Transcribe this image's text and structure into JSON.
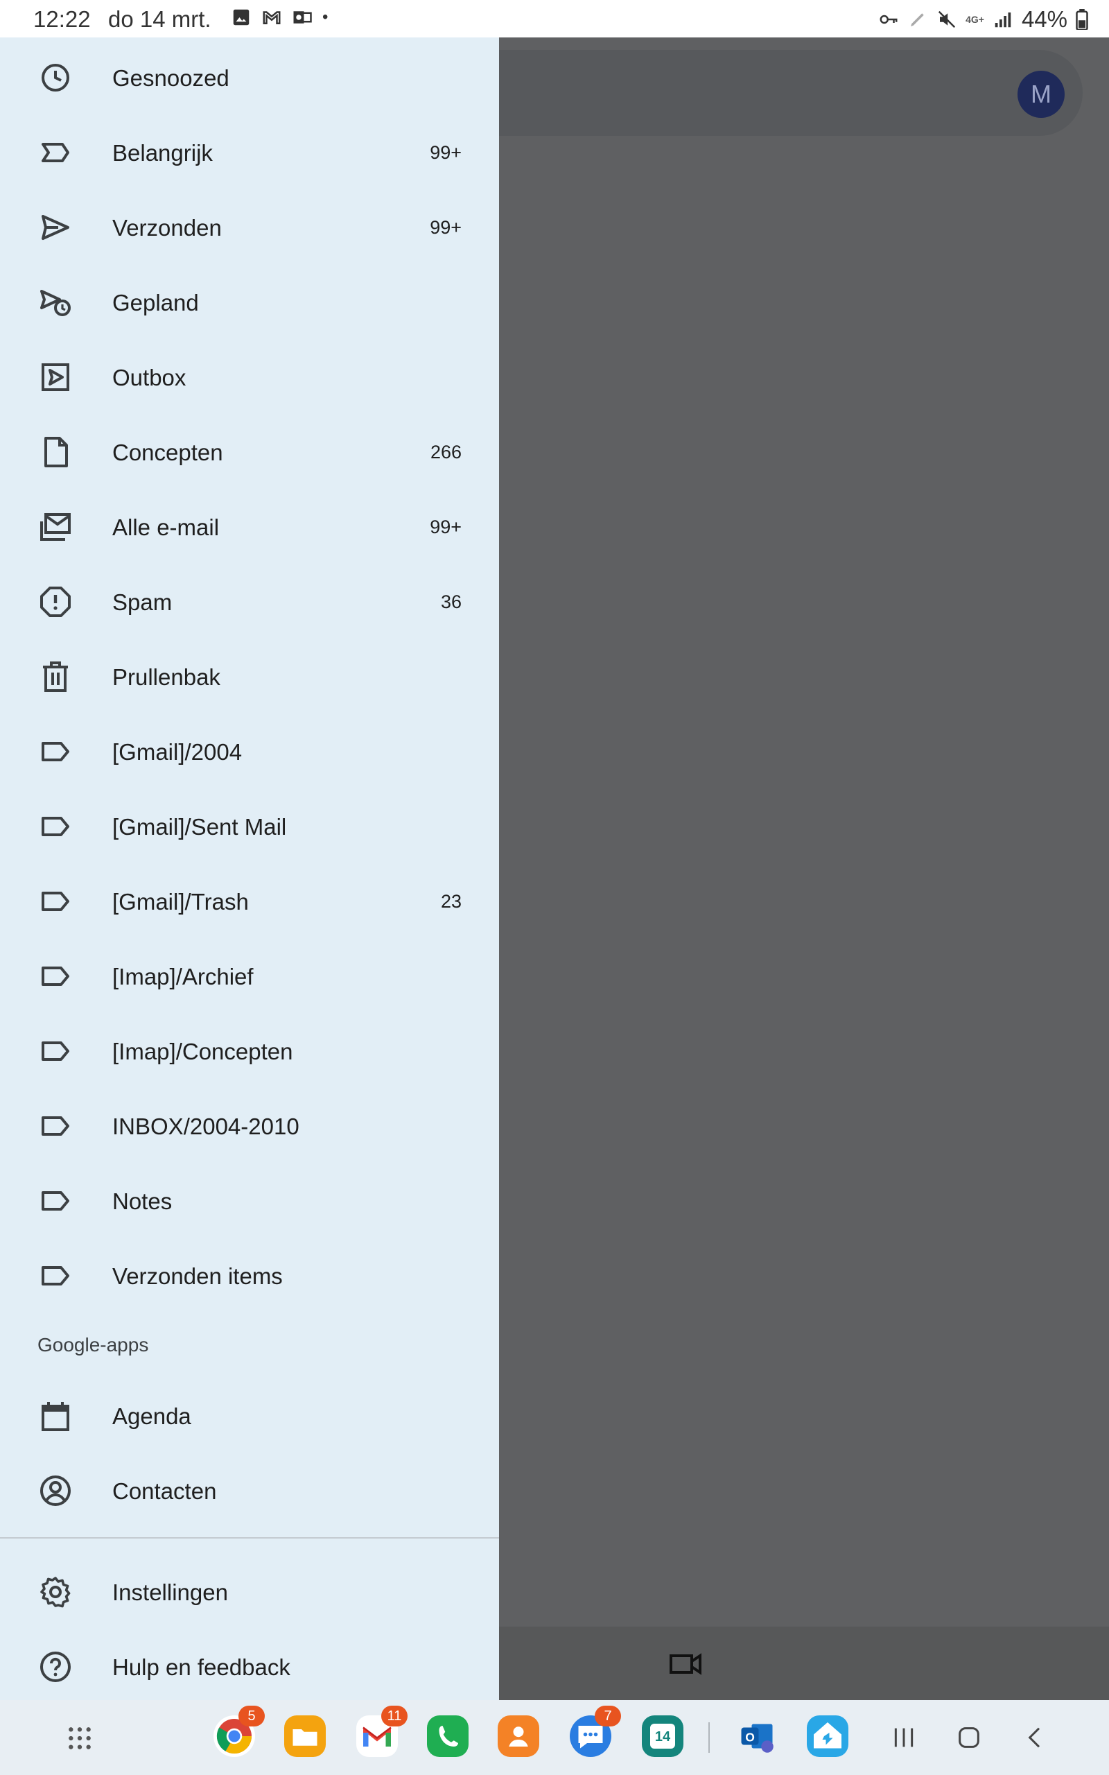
{
  "status_bar": {
    "time": "12:22",
    "date": "do 14 mrt.",
    "battery": "44%",
    "network": "4G+"
  },
  "background": {
    "avatar_letter": "M"
  },
  "drawer": {
    "items": [
      {
        "label": "Gesnoozed",
        "count": "",
        "icon": "clock-icon"
      },
      {
        "label": "Belangrijk",
        "count": "99+",
        "icon": "important-icon"
      },
      {
        "label": "Verzonden",
        "count": "99+",
        "icon": "send-icon"
      },
      {
        "label": "Gepland",
        "count": "",
        "icon": "scheduled-send-icon"
      },
      {
        "label": "Outbox",
        "count": "",
        "icon": "outbox-icon"
      },
      {
        "label": "Concepten",
        "count": "266",
        "icon": "draft-icon"
      },
      {
        "label": "Alle e-mail",
        "count": "99+",
        "icon": "all-mail-icon"
      },
      {
        "label": "Spam",
        "count": "36",
        "icon": "spam-icon"
      },
      {
        "label": "Prullenbak",
        "count": "",
        "icon": "trash-icon"
      },
      {
        "label": "[Gmail]/2004",
        "count": "",
        "icon": "label-icon"
      },
      {
        "label": "[Gmail]/Sent Mail",
        "count": "",
        "icon": "label-icon"
      },
      {
        "label": "[Gmail]/Trash",
        "count": "23",
        "icon": "label-icon"
      },
      {
        "label": "[Imap]/Archief",
        "count": "",
        "icon": "label-icon"
      },
      {
        "label": "[Imap]/Concepten",
        "count": "",
        "icon": "label-icon"
      },
      {
        "label": "INBOX/2004-2010",
        "count": "",
        "icon": "label-icon"
      },
      {
        "label": "Notes",
        "count": "",
        "icon": "label-icon"
      },
      {
        "label": "Verzonden items",
        "count": "",
        "icon": "label-icon"
      }
    ],
    "google_apps_header": "Google-apps",
    "google_apps": [
      {
        "label": "Agenda",
        "icon": "calendar-icon"
      },
      {
        "label": "Contacten",
        "icon": "contacts-icon"
      }
    ],
    "footer": [
      {
        "label": "Instellingen",
        "icon": "settings-icon"
      },
      {
        "label": "Hulp en feedback",
        "icon": "help-icon"
      }
    ]
  },
  "navbar": {
    "apps": [
      {
        "name": "chrome",
        "badge": "5",
        "color": "#ffffff"
      },
      {
        "name": "files",
        "badge": "",
        "color": "#f4a30f"
      },
      {
        "name": "gmail",
        "badge": "11",
        "color": "#ffffff"
      },
      {
        "name": "phone",
        "badge": "",
        "color": "#1fae52"
      },
      {
        "name": "contacts",
        "badge": "",
        "color": "#f48226"
      },
      {
        "name": "messages",
        "badge": "7",
        "color": "#2a7de1"
      },
      {
        "name": "calendar",
        "badge": "",
        "color": "#14857c",
        "text": "14"
      },
      {
        "name": "outlook",
        "badge": "",
        "color": "#ffffff"
      },
      {
        "name": "home",
        "badge": "",
        "color": "#29a7e6"
      }
    ]
  }
}
